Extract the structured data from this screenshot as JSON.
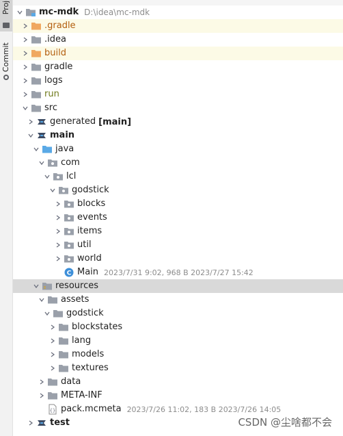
{
  "sidebar": {
    "project_tab": "Proje",
    "commit_tab": "Commit"
  },
  "root": {
    "name": "mc-mdk",
    "path": "D:\\idea\\mc-mdk"
  },
  "tree": {
    "gradle_hidden": ".gradle",
    "idea": ".idea",
    "build": "build",
    "gradle": "gradle",
    "logs": "logs",
    "run": "run",
    "src": "src",
    "generated": "generated",
    "generated_tag": "[main]",
    "main": "main",
    "java": "java",
    "com": "com",
    "lcl": "lcl",
    "godstick": "godstick",
    "blocks": "blocks",
    "events": "events",
    "items": "items",
    "util": "util",
    "world": "world",
    "main_class": "Main",
    "main_class_meta": "2023/7/31 9:02, 968 B 2023/7/27 15:42",
    "resources": "resources",
    "assets": "assets",
    "assets_godstick": "godstick",
    "blockstates": "blockstates",
    "lang": "lang",
    "models": "models",
    "textures": "textures",
    "data": "data",
    "meta_inf": "META-INF",
    "pack_mcmeta": "pack.mcmeta",
    "pack_mcmeta_meta": "2023/7/26 11:02, 183 B 2023/7/26 14:05",
    "test": "test"
  },
  "watermark": "CSDN @尘啥都不会",
  "colors": {
    "folder": "#9aa0aa",
    "excluded_folder": "#f0a860",
    "source_folder": "#5aa9e6",
    "resources_folder": "#c6a34a",
    "class_icon": "#3d8fd9",
    "ignored_row": "#fcfae6",
    "selected_row": "#d9d9d9"
  }
}
